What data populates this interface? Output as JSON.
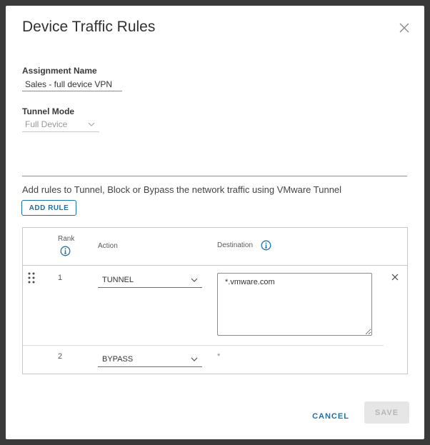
{
  "modal": {
    "title": "Device Traffic Rules"
  },
  "assignment": {
    "label": "Assignment Name",
    "value": "Sales - full device VPN"
  },
  "tunnel_mode": {
    "label": "Tunnel Mode",
    "value": "Full Device"
  },
  "helper_text": "Add rules to Tunnel, Block or Bypass the network traffic using VMware Tunnel",
  "add_rule_label": "ADD RULE",
  "table": {
    "headers": {
      "rank": "Rank",
      "action": "Action",
      "destination": "Destination"
    },
    "rows": [
      {
        "rank": "1",
        "action": "TUNNEL",
        "destination": "*.vmware.com"
      },
      {
        "rank": "2",
        "action": "BYPASS",
        "destination": "*"
      }
    ]
  },
  "footer": {
    "cancel_label": "CANCEL",
    "save_label": "SAVE"
  },
  "colors": {
    "accent": "#1a73a8",
    "disabled_bg": "#e6e6e6"
  },
  "icons": [
    "close-icon",
    "chevron-down-icon",
    "info-icon",
    "drag-handle-icon"
  ]
}
